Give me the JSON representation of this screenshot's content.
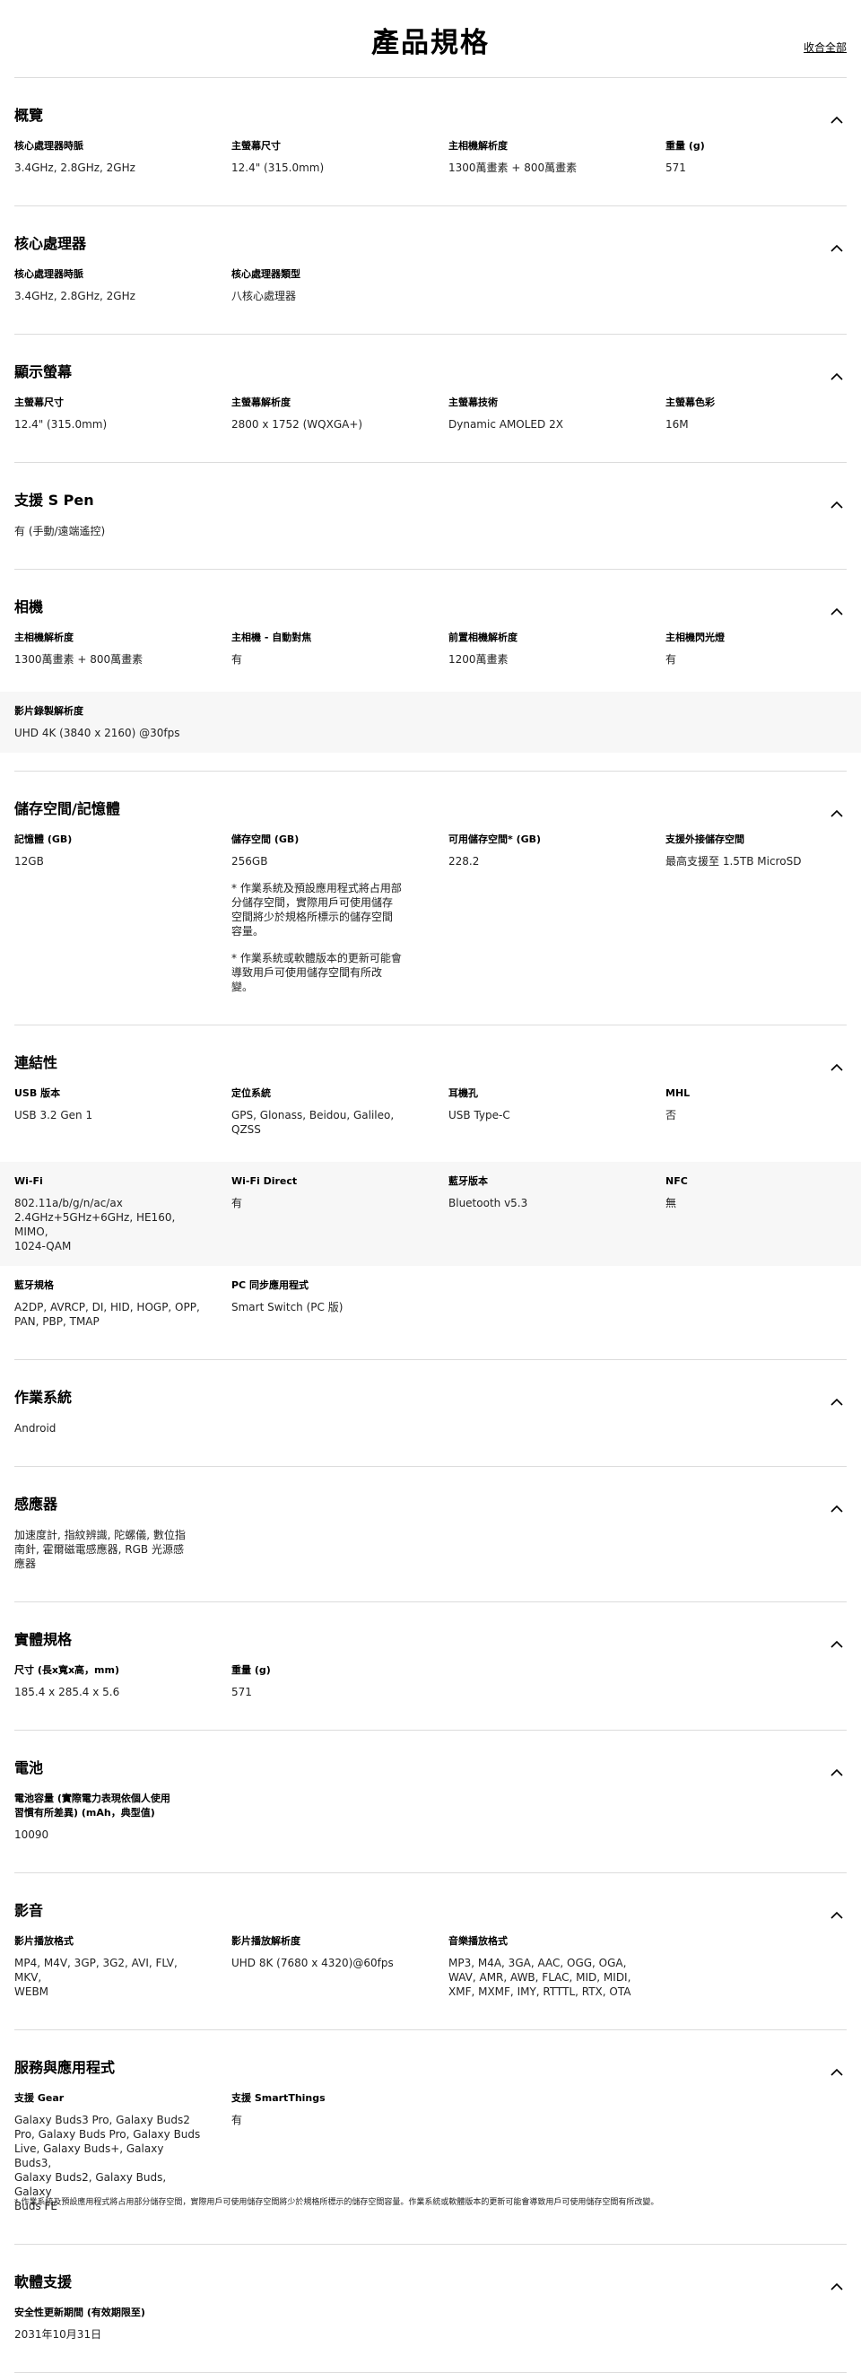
{
  "header": {
    "title": "產品規格",
    "collapse_all": "收合全部"
  },
  "sections": [
    {
      "title": "概覽",
      "rows": [
        {
          "shaded": false,
          "cells": [
            {
              "label": "核心處理器時脈",
              "value": "3.4GHz, 2.8GHz, 2GHz"
            },
            {
              "label": "主螢幕尺寸",
              "value": "12.4\" (315.0mm)"
            },
            {
              "label": "主相機解析度",
              "value": "1300萬畫素 + 800萬畫素"
            },
            {
              "label": "重量 (g)",
              "value": "571"
            }
          ]
        }
      ]
    },
    {
      "title": "核心處理器",
      "rows": [
        {
          "shaded": false,
          "cells": [
            {
              "label": "核心處理器時脈",
              "value": "3.4GHz, 2.8GHz, 2GHz"
            },
            {
              "label": "核心處理器類型",
              "value": "八核心處理器"
            }
          ]
        }
      ]
    },
    {
      "title": "顯示螢幕",
      "rows": [
        {
          "shaded": false,
          "cells": [
            {
              "label": "主螢幕尺寸",
              "value": "12.4\" (315.0mm)"
            },
            {
              "label": "主螢幕解析度",
              "value": "2800 x 1752 (WQXGA+)"
            },
            {
              "label": "主螢幕技術",
              "value": "Dynamic AMOLED 2X"
            },
            {
              "label": "主螢幕色彩",
              "value": "16M"
            }
          ]
        }
      ]
    },
    {
      "title": "支援 S Pen",
      "rows": [
        {
          "shaded": false,
          "cells": [
            {
              "label": "",
              "value": "有 (手動/遠端遙控)"
            }
          ]
        }
      ]
    },
    {
      "title": "相機",
      "rows": [
        {
          "shaded": false,
          "cells": [
            {
              "label": "主相機解析度",
              "value": "1300萬畫素 + 800萬畫素"
            },
            {
              "label": "主相機 - 自動對焦",
              "value": "有"
            },
            {
              "label": "前置相機解析度",
              "value": "1200萬畫素"
            },
            {
              "label": "主相機閃光燈",
              "value": "有"
            }
          ]
        },
        {
          "shaded": true,
          "cells": [
            {
              "label": "影片錄製解析度",
              "value": "UHD 4K (3840 x 2160) @30fps"
            }
          ]
        }
      ]
    },
    {
      "title": "儲存空間/記憶體",
      "rows": [
        {
          "shaded": false,
          "cells": [
            {
              "label": "記憶體 (GB)",
              "value": "12GB"
            },
            {
              "label": "儲存空間 (GB)",
              "value": "256GB",
              "notes": [
                "* 作業系統及預設應用程式將占用部\n分儲存空間，實際用戶可使用儲存\n空間將少於規格所標示的儲存空間\n容量。",
                "* 作業系統或軟體版本的更新可能會\n導致用戶可使用儲存空間有所改\n變。"
              ]
            },
            {
              "label": "可用儲存空間* (GB)",
              "value": "228.2"
            },
            {
              "label": "支援外接儲存空間",
              "value": "最高支援至 1.5TB MicroSD"
            }
          ]
        }
      ]
    },
    {
      "title": "連結性",
      "rows": [
        {
          "shaded": false,
          "cells": [
            {
              "label": "USB 版本",
              "value": "USB 3.2 Gen 1"
            },
            {
              "label": "定位系統",
              "value": "GPS, Glonass, Beidou, Galileo, QZSS"
            },
            {
              "label": "耳機孔",
              "value": "USB Type-C"
            },
            {
              "label": "MHL",
              "value": "否"
            }
          ]
        },
        {
          "shaded": true,
          "cells": [
            {
              "label": "Wi-Fi",
              "value": "802.11a/b/g/n/ac/ax\n2.4GHz+5GHz+6GHz, HE160, MIMO,\n1024-QAM"
            },
            {
              "label": "Wi-Fi Direct",
              "value": "有"
            },
            {
              "label": "藍牙版本",
              "value": "Bluetooth v5.3"
            },
            {
              "label": "NFC",
              "value": "無"
            }
          ]
        },
        {
          "shaded": false,
          "cells": [
            {
              "label": "藍牙規格",
              "value": "A2DP, AVRCP, DI, HID, HOGP, OPP,\nPAN, PBP, TMAP"
            },
            {
              "label": "PC 同步應用程式",
              "value": "Smart Switch (PC 版)"
            }
          ]
        }
      ]
    },
    {
      "title": "作業系統",
      "rows": [
        {
          "shaded": false,
          "cells": [
            {
              "label": "",
              "value": "Android"
            }
          ]
        }
      ]
    },
    {
      "title": "感應器",
      "rows": [
        {
          "shaded": false,
          "cells": [
            {
              "label": "",
              "value": "加速度計, 指紋辨識, 陀螺儀, 數位指\n南針, 霍爾磁電感應器, RGB 光源感\n應器"
            }
          ]
        }
      ]
    },
    {
      "title": "實體規格",
      "rows": [
        {
          "shaded": false,
          "cells": [
            {
              "label": "尺寸 (長x寬x高，mm)",
              "value": "185.4 x 285.4 x 5.6"
            },
            {
              "label": "重量 (g)",
              "value": "571"
            }
          ]
        }
      ]
    },
    {
      "title": "電池",
      "rows": [
        {
          "shaded": false,
          "cells": [
            {
              "label": "電池容量 (實際電力表現依個人使用\n習慣有所差異) (mAh，典型值)",
              "value": "10090"
            }
          ]
        }
      ]
    },
    {
      "title": "影音",
      "rows": [
        {
          "shaded": false,
          "cells": [
            {
              "label": "影片播放格式",
              "value": "MP4, M4V, 3GP, 3G2, AVI, FLV, MKV,\nWEBM"
            },
            {
              "label": "影片播放解析度",
              "value": "UHD 8K (7680 x 4320)@60fps"
            },
            {
              "label": "音樂播放格式",
              "value": "MP3, M4A, 3GA, AAC, OGG, OGA,\nWAV, AMR, AWB, FLAC, MID, MIDI,\nXMF, MXMF, IMY, RTTTL, RTX, OTA"
            }
          ]
        }
      ]
    },
    {
      "title": "服務與應用程式",
      "rows": [
        {
          "shaded": false,
          "cells": [
            {
              "label": "支援 Gear",
              "value": "Galaxy Buds3 Pro, Galaxy Buds2\nPro, Galaxy Buds Pro, Galaxy Buds\nLive, Galaxy Buds+, Galaxy Buds3,\nGalaxy Buds2, Galaxy Buds, Galaxy\nBuds FE"
            },
            {
              "label": "支援 SmartThings",
              "value": "有"
            }
          ]
        }
      ]
    },
    {
      "title": "軟體支援",
      "rows": [
        {
          "shaded": false,
          "cells": [
            {
              "label": "安全性更新期間 (有效期限至)",
              "value": "2031年10月31日"
            }
          ]
        }
      ]
    }
  ],
  "footnote": "* 作業系統及預設應用程式將占用部分儲存空間，實際用戶可使用儲存空間將少於規格所標示的儲存空間容量。作業系統或軟體版本的更新可能會導致用戶可使用儲存空間有所改變。",
  "icons": {
    "section_toggle": "chevron-up-icon"
  },
  "colors": {
    "divider": "#dcdcdc",
    "shaded_row": "#f7f7f7"
  }
}
